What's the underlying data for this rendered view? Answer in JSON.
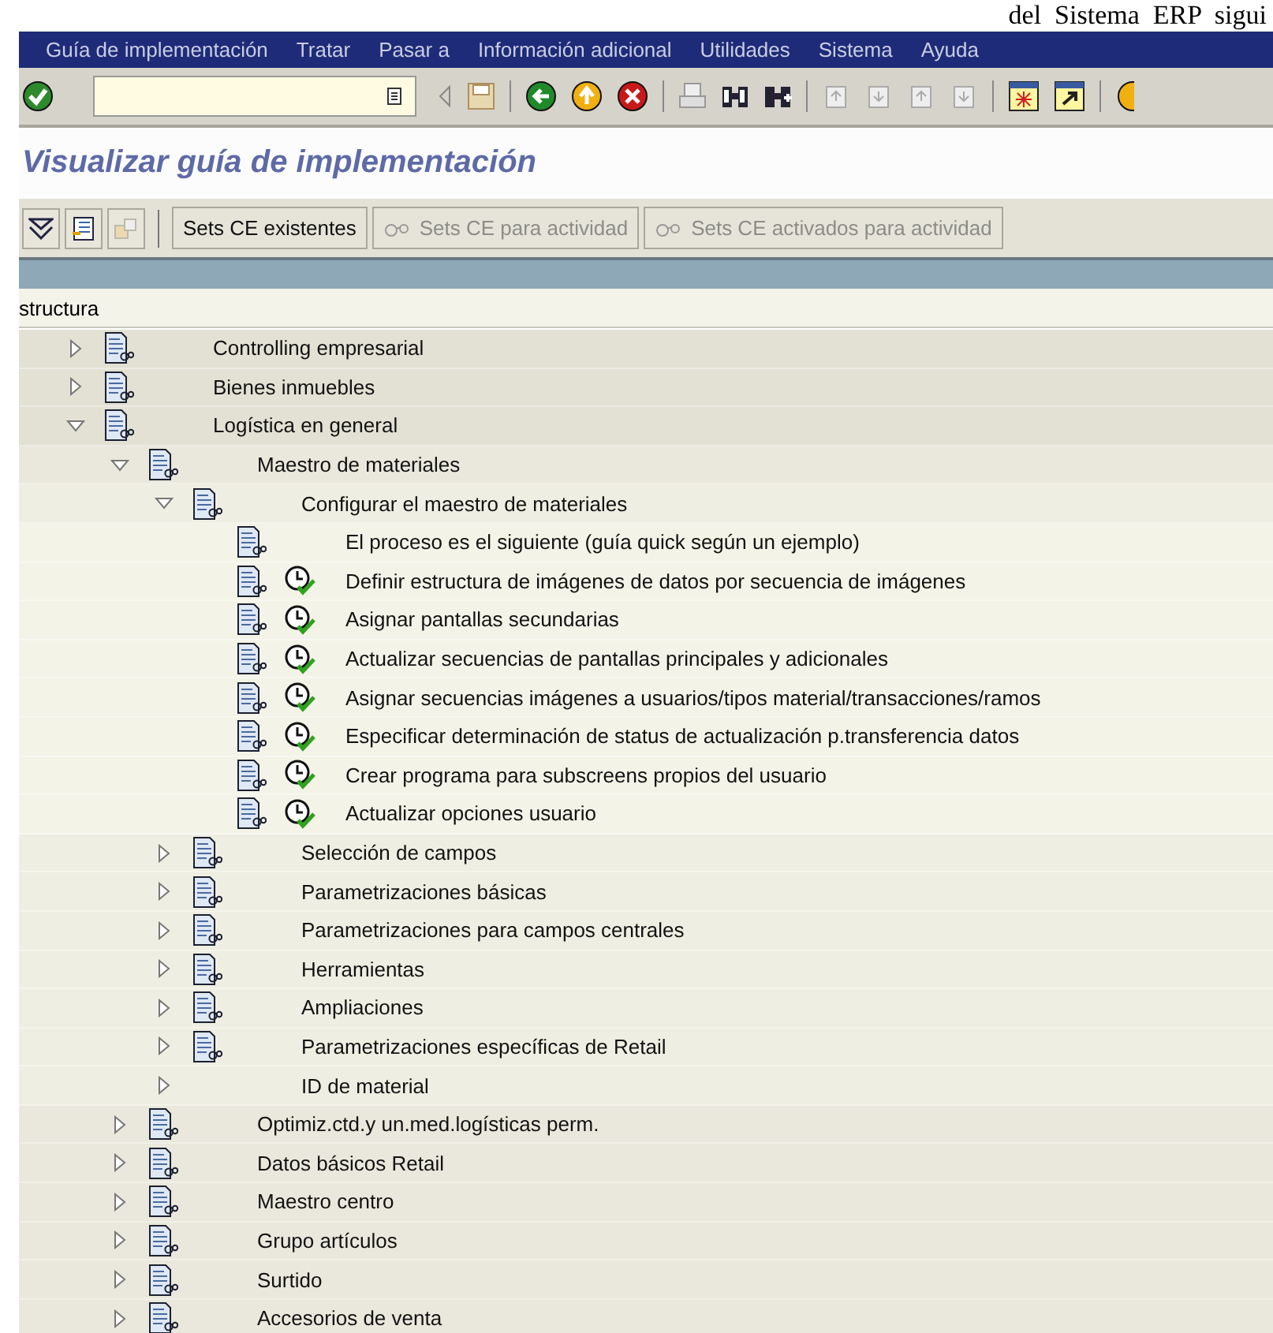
{
  "document_caption": "del  Sistema  ERP  sigui",
  "menu_bar": [
    {
      "label": "Guía de implementación"
    },
    {
      "label": "Tratar"
    },
    {
      "label": "Pasar a"
    },
    {
      "label": "Información adicional"
    },
    {
      "label": "Utilidades"
    },
    {
      "label": "Sistema"
    },
    {
      "label": "Ayuda"
    }
  ],
  "title": "Visualizar guía de implementación",
  "app_toolbar": [
    {
      "label": "Sets CE existentes",
      "disabled": false
    },
    {
      "label": "Sets CE para actividad",
      "disabled": true
    },
    {
      "label": "Sets CE activados para actividad",
      "disabled": true
    }
  ],
  "tree_header": "structura",
  "tree": [
    {
      "kind": "folder",
      "label": "Controlling empresarial",
      "expanded": false
    },
    {
      "kind": "folder",
      "label": "Bienes inmuebles",
      "expanded": false
    },
    {
      "kind": "folder",
      "label": "Logística en general",
      "expanded": true,
      "children": [
        {
          "kind": "folder",
          "label": "Maestro de materiales",
          "expanded": true,
          "children": [
            {
              "kind": "folder",
              "label": "Configurar el maestro de materiales",
              "expanded": true,
              "children": [
                {
                  "kind": "note",
                  "label": "El proceso es el siguiente (guía quick según un ejemplo)"
                },
                {
                  "kind": "activity",
                  "label": "Definir estructura de imágenes de datos por secuencia de imágenes"
                },
                {
                  "kind": "activity",
                  "label": "Asignar pantallas secundarias"
                },
                {
                  "kind": "activity",
                  "label": "Actualizar secuencias de pantallas principales y adicionales"
                },
                {
                  "kind": "activity",
                  "label": "Asignar secuencias imágenes a usuarios/tipos material/transacciones/ramos"
                },
                {
                  "kind": "activity",
                  "label": "Especificar determinación de status de actualización p.transferencia datos"
                },
                {
                  "kind": "activity",
                  "label": "Crear programa para subscreens propios del usuario"
                },
                {
                  "kind": "activity",
                  "label": "Actualizar opciones usuario"
                }
              ]
            },
            {
              "kind": "folder",
              "label": "Selección de campos",
              "expanded": false
            },
            {
              "kind": "folder",
              "label": "Parametrizaciones básicas",
              "expanded": false
            },
            {
              "kind": "folder",
              "label": "Parametrizaciones para campos centrales",
              "expanded": false
            },
            {
              "kind": "folder",
              "label": "Herramientas",
              "expanded": false
            },
            {
              "kind": "folder",
              "label": "Ampliaciones",
              "expanded": false
            },
            {
              "kind": "folder",
              "label": "Parametrizaciones específicas de Retail",
              "expanded": false
            },
            {
              "kind": "group",
              "label": "ID de material",
              "expanded": false
            }
          ]
        },
        {
          "kind": "folder",
          "label": "Optimiz.ctd.y un.med.logísticas perm.",
          "expanded": false
        },
        {
          "kind": "folder",
          "label": "Datos básicos Retail",
          "expanded": false
        },
        {
          "kind": "folder",
          "label": "Maestro centro",
          "expanded": false
        },
        {
          "kind": "folder",
          "label": "Grupo artículos",
          "expanded": false
        },
        {
          "kind": "folder",
          "label": "Surtido",
          "expanded": false
        },
        {
          "kind": "folder",
          "label": "Accesorios de venta",
          "expanded": false
        }
      ]
    }
  ]
}
